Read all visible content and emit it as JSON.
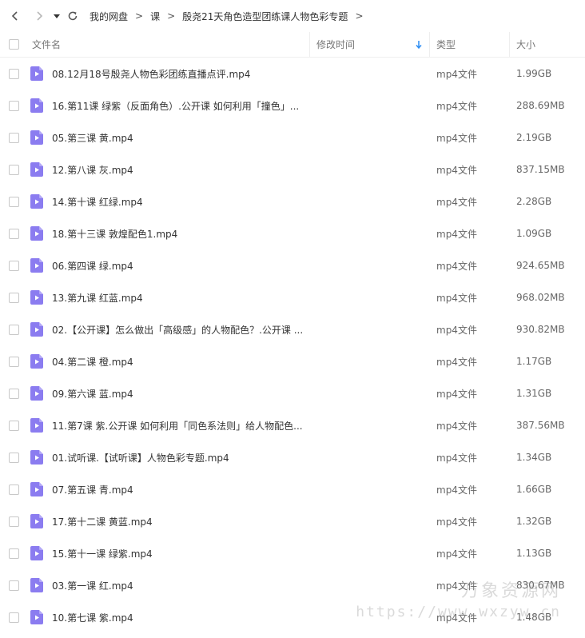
{
  "breadcrumb": {
    "items": [
      "我的网盘",
      "课",
      "殷尧21天角色造型团练课人物色彩专题"
    ],
    "separator": ">"
  },
  "columns": {
    "name": "文件名",
    "mtime": "修改时间",
    "type": "类型",
    "size": "大小",
    "sort_icon": "arrow-down-icon"
  },
  "files": [
    {
      "name": "08.12月18号殷尧人物色彩团练直播点评.mp4",
      "type": "mp4文件",
      "size": "1.99GB"
    },
    {
      "name": "16.第11课 绿紫（反面角色）.公开课 如何利用「撞色」...",
      "type": "mp4文件",
      "size": "288.69MB"
    },
    {
      "name": "05.第三课 黄.mp4",
      "type": "mp4文件",
      "size": "2.19GB"
    },
    {
      "name": "12.第八课 灰.mp4",
      "type": "mp4文件",
      "size": "837.15MB"
    },
    {
      "name": "14.第十课 红绿.mp4",
      "type": "mp4文件",
      "size": "2.28GB"
    },
    {
      "name": "18.第十三课 敦煌配色1.mp4",
      "type": "mp4文件",
      "size": "1.09GB"
    },
    {
      "name": "06.第四课 绿.mp4",
      "type": "mp4文件",
      "size": "924.65MB"
    },
    {
      "name": "13.第九课 红蓝.mp4",
      "type": "mp4文件",
      "size": "968.02MB"
    },
    {
      "name": "02.【公开课】怎么做出「高级感」的人物配色？.公开课 ...",
      "type": "mp4文件",
      "size": "930.82MB"
    },
    {
      "name": "04.第二课 橙.mp4",
      "type": "mp4文件",
      "size": "1.17GB"
    },
    {
      "name": "09.第六课 蓝.mp4",
      "type": "mp4文件",
      "size": "1.31GB"
    },
    {
      "name": "11.第7课 紫.公开课 如何利用「同色系法则」给人物配色...",
      "type": "mp4文件",
      "size": "387.56MB"
    },
    {
      "name": "01.试听课.【试听课】人物色彩专题.mp4",
      "type": "mp4文件",
      "size": "1.34GB"
    },
    {
      "name": "07.第五课 青.mp4",
      "type": "mp4文件",
      "size": "1.66GB"
    },
    {
      "name": "17.第十二课  黄蓝.mp4",
      "type": "mp4文件",
      "size": "1.32GB"
    },
    {
      "name": "15.第十一课 绿紫.mp4",
      "type": "mp4文件",
      "size": "1.13GB"
    },
    {
      "name": "03.第一课 红.mp4",
      "type": "mp4文件",
      "size": "830.67MB"
    },
    {
      "name": "10.第七课 紫.mp4",
      "type": "mp4文件",
      "size": "1.48GB"
    }
  ],
  "watermark": {
    "text": "万象资源网",
    "url": "https://www.wxzyw.cn"
  },
  "colors": {
    "file_icon": "#8b7cf0",
    "sort_arrow": "#2b8cf3"
  }
}
